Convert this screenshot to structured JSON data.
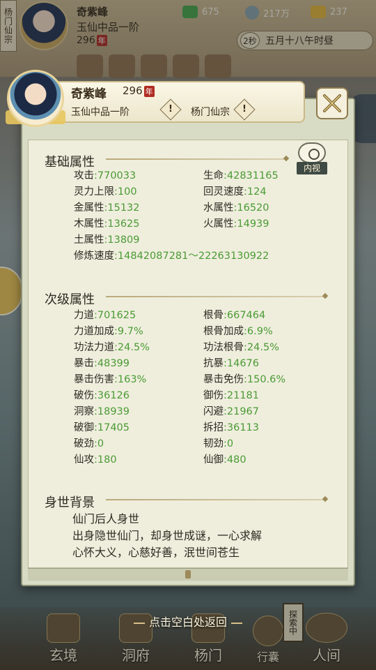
{
  "top_hud": {
    "guild_tag": "杨门仙宗",
    "player_name": "奇紫峰",
    "realm": "玉仙中品一阶",
    "age_value": "296",
    "age_unit": "年",
    "resources": [
      {
        "name": "jade-currency",
        "value": "675",
        "color": "#4aa34a"
      },
      {
        "name": "coin-currency",
        "value": "217万",
        "color": "#8aa0a6"
      },
      {
        "name": "gold-cross",
        "value": "237",
        "color": "#e0b33a"
      }
    ],
    "time_badge": "2秒",
    "time_text": "五月十八午时昼"
  },
  "panel": {
    "name": "奇紫峰",
    "level": "296",
    "level_unit": "年",
    "realm": "玉仙中品一阶",
    "sect": "杨门仙宗",
    "info_mark": "!",
    "neishi_label": "内视",
    "base_title": "基础属性",
    "base_attrs": [
      {
        "label": "攻击",
        "value": ":770033"
      },
      {
        "label": "生命",
        "value": ":42831165"
      },
      {
        "label": "灵力上限",
        "value": ":100"
      },
      {
        "label": "回灵速度",
        "value": ":124"
      },
      {
        "label": "金属性",
        "value": ":15132"
      },
      {
        "label": "水属性",
        "value": ":16520"
      },
      {
        "label": "木属性",
        "value": ":13625"
      },
      {
        "label": "火属性",
        "value": ":14939"
      },
      {
        "label": "土属性",
        "value": ":13809"
      },
      {
        "label": "修炼速度",
        "value": ":14842087281～22263130922"
      }
    ],
    "secondary_title": "次级属性",
    "secondary_attrs": [
      {
        "label": "力道",
        "value": ":701625"
      },
      {
        "label": "根骨",
        "value": ":667464"
      },
      {
        "label": "力道加成",
        "value": ":9.7%"
      },
      {
        "label": "根骨加成",
        "value": ":6.9%"
      },
      {
        "label": "功法力道",
        "value": ":24.5%"
      },
      {
        "label": "功法根骨",
        "value": ":24.5%"
      },
      {
        "label": "暴击",
        "value": ":48399"
      },
      {
        "label": "抗暴",
        "value": ":14676"
      },
      {
        "label": "暴击伤害",
        "value": ":163%"
      },
      {
        "label": "暴击免伤",
        "value": ":150.6%"
      },
      {
        "label": "破伤",
        "value": ":36126"
      },
      {
        "label": "御伤",
        "value": ":21181"
      },
      {
        "label": "洞察",
        "value": ":18939"
      },
      {
        "label": "闪避",
        "value": ":21967"
      },
      {
        "label": "破御",
        "value": ":17405"
      },
      {
        "label": "拆招",
        "value": ":36113"
      },
      {
        "label": "破劲",
        "value": ":0"
      },
      {
        "label": "韧劲",
        "value": ":0"
      },
      {
        "label": "仙攻",
        "value": ":180"
      },
      {
        "label": "仙御",
        "value": ":480"
      }
    ],
    "bio_title": "身世背景",
    "bio_lines": [
      "仙门后人身世",
      "出身隐世仙门，却身世成谜，一心求解",
      "心怀大义，心慈好善，泯世间苍生"
    ]
  },
  "return_hint": "点击空白处返回",
  "bottom_nav": {
    "items": [
      "玄境",
      "洞府",
      "杨门",
      "行囊",
      "人间"
    ],
    "explore_tag": "探索中"
  }
}
